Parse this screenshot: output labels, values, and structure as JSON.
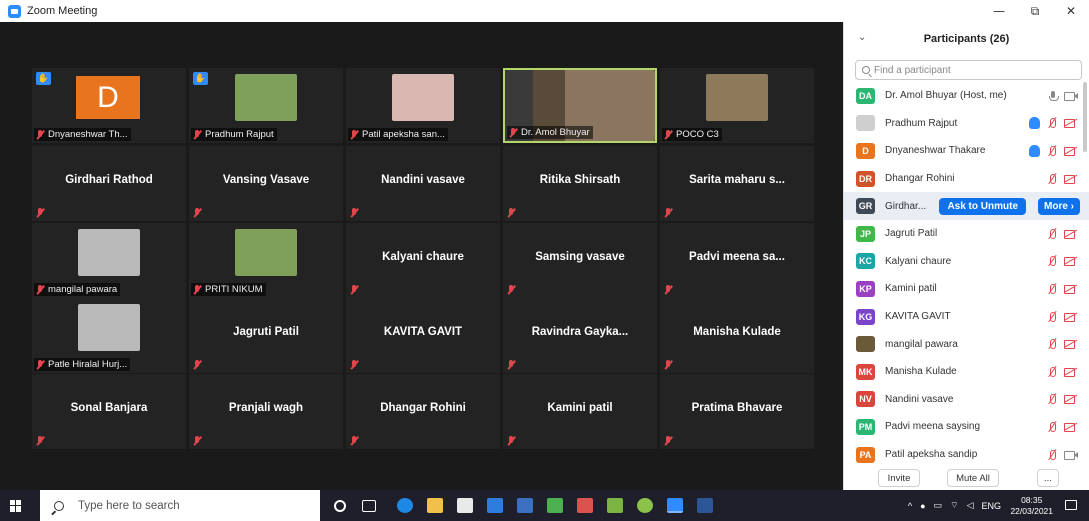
{
  "window": {
    "title": "Zoom Meeting",
    "controls": {
      "minimize": "—",
      "restore": "⧉",
      "close": "✕"
    }
  },
  "gallery": {
    "tiles": [
      {
        "name": "Dnyaneshwar Th...",
        "kind": "avatar",
        "avatar_letter": "D",
        "hand_raised": true
      },
      {
        "name": "Pradhum Rajput",
        "kind": "photo",
        "hand_raised": true
      },
      {
        "name": "Patil apeksha san...",
        "kind": "photo"
      },
      {
        "name": "Dr. Amol Bhuyar",
        "kind": "video",
        "active_speaker": true
      },
      {
        "name": "POCO C3",
        "kind": "photo"
      },
      {
        "name": "Girdhari Rathod",
        "kind": "text"
      },
      {
        "name": "Vansing Vasave",
        "kind": "text"
      },
      {
        "name": "Nandini vasave",
        "kind": "text"
      },
      {
        "name": "Ritika Shirsath",
        "kind": "text"
      },
      {
        "name": "Sarita maharu s...",
        "kind": "text"
      },
      {
        "name": "mangilal pawara",
        "kind": "photo"
      },
      {
        "name": "PRITI NIKUM",
        "kind": "photo"
      },
      {
        "name": "Kalyani chaure",
        "kind": "text"
      },
      {
        "name": "Samsing vasave",
        "kind": "text"
      },
      {
        "name": "Padvi meena sa...",
        "kind": "text"
      },
      {
        "name": "Patle Hiralal Hurj...",
        "kind": "photo"
      },
      {
        "name": "Jagruti Patil",
        "kind": "text"
      },
      {
        "name": "KAVITA GAVIT",
        "kind": "text"
      },
      {
        "name": "Ravindra  Gayka...",
        "kind": "text"
      },
      {
        "name": "Manisha Kulade",
        "kind": "text"
      },
      {
        "name": "Sonal Banjara",
        "kind": "text"
      },
      {
        "name": "Pranjali wagh",
        "kind": "text"
      },
      {
        "name": "Dhangar Rohini",
        "kind": "text"
      },
      {
        "name": "Kamini patil",
        "kind": "text"
      },
      {
        "name": "Pratima Bhavare",
        "kind": "text"
      }
    ]
  },
  "participants": {
    "title": "Participants (26)",
    "search_placeholder": "Find a participant",
    "items": [
      {
        "initials": "DA",
        "color": "#2bb673",
        "name": "Dr. Amol Bhuyar (Host, me)",
        "icons": "host"
      },
      {
        "initials": "",
        "color": "#cfcfcf",
        "name": "Pradhum Rajput",
        "icons": "hand",
        "photo": true
      },
      {
        "initials": "D",
        "color": "#e8741e",
        "name": "Dnyaneshwar Thakare",
        "icons": "hand"
      },
      {
        "initials": "DR",
        "color": "#d0532a",
        "name": "Dhangar Rohini",
        "icons": "muted"
      },
      {
        "initials": "GR",
        "color": "#3f4a56",
        "name": "Girdhar...",
        "icons": "hover"
      },
      {
        "initials": "JP",
        "color": "#41b649",
        "name": "Jagruti Patil",
        "icons": "muted"
      },
      {
        "initials": "KC",
        "color": "#1aa6a6",
        "name": "Kalyani chaure",
        "icons": "muted"
      },
      {
        "initials": "KP",
        "color": "#9b3fc4",
        "name": "Kamini patil",
        "icons": "muted"
      },
      {
        "initials": "KG",
        "color": "#7a45c9",
        "name": "KAVITA GAVIT",
        "icons": "muted"
      },
      {
        "initials": "",
        "color": "#6b5a3a",
        "name": "mangilal pawara",
        "icons": "muted",
        "photo": true
      },
      {
        "initials": "MK",
        "color": "#d9463b",
        "name": "Manisha Kulade",
        "icons": "muted"
      },
      {
        "initials": "NV",
        "color": "#d9463b",
        "name": "Nandini vasave",
        "icons": "muted"
      },
      {
        "initials": "PM",
        "color": "#2bb673",
        "name": "Padvi meena saysing",
        "icons": "muted"
      },
      {
        "initials": "PA",
        "color": "#e8741e",
        "name": "Patil apeksha sandip",
        "icons": "muted-cam"
      }
    ],
    "hover_actions": {
      "unmute": "Ask to Unmute",
      "more": "More ›"
    },
    "footer": {
      "invite": "Invite",
      "mute_all": "Mute All",
      "more": "..."
    }
  },
  "taskbar": {
    "search_placeholder": "Type here to search",
    "tray": {
      "language": "ENG",
      "time": "08:35",
      "date": "22/03/2021"
    }
  }
}
